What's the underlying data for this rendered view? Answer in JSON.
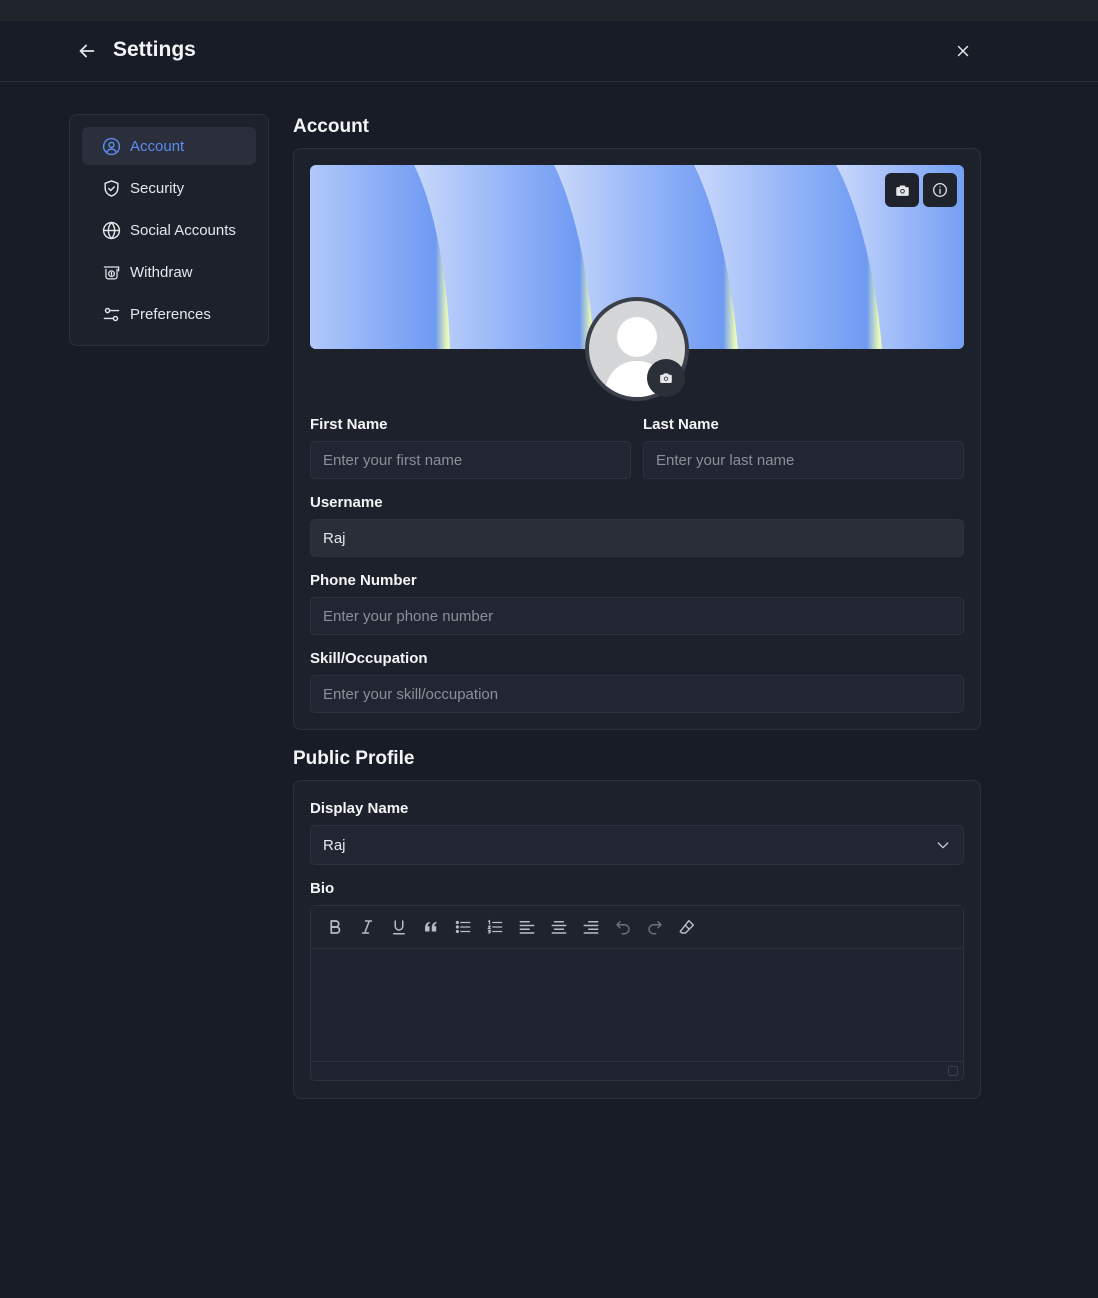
{
  "header": {
    "title": "Settings"
  },
  "sidebar": {
    "items": [
      {
        "label": "Account",
        "icon": "user-circle-icon",
        "active": true
      },
      {
        "label": "Security",
        "icon": "shield-check-icon"
      },
      {
        "label": "Social Accounts",
        "icon": "globe-icon"
      },
      {
        "label": "Withdraw",
        "icon": "money-icon"
      },
      {
        "label": "Preferences",
        "icon": "sliders-icon"
      }
    ]
  },
  "account": {
    "title": "Account",
    "first_name": {
      "label": "First Name",
      "placeholder": "Enter your first name"
    },
    "last_name": {
      "label": "Last Name",
      "placeholder": "Enter your last name"
    },
    "username": {
      "label": "Username",
      "value": "Raj"
    },
    "phone": {
      "label": "Phone Number",
      "placeholder": "Enter your phone number"
    },
    "skill": {
      "label": "Skill/Occupation",
      "placeholder": "Enter your skill/occupation"
    }
  },
  "public_profile": {
    "title": "Public Profile",
    "display_name": {
      "label": "Display Name",
      "value": "Raj"
    },
    "bio": {
      "label": "Bio",
      "value": ""
    }
  },
  "colors": {
    "accent": "#5b8cf0",
    "background": "#181c26",
    "card": "#1d212b"
  }
}
